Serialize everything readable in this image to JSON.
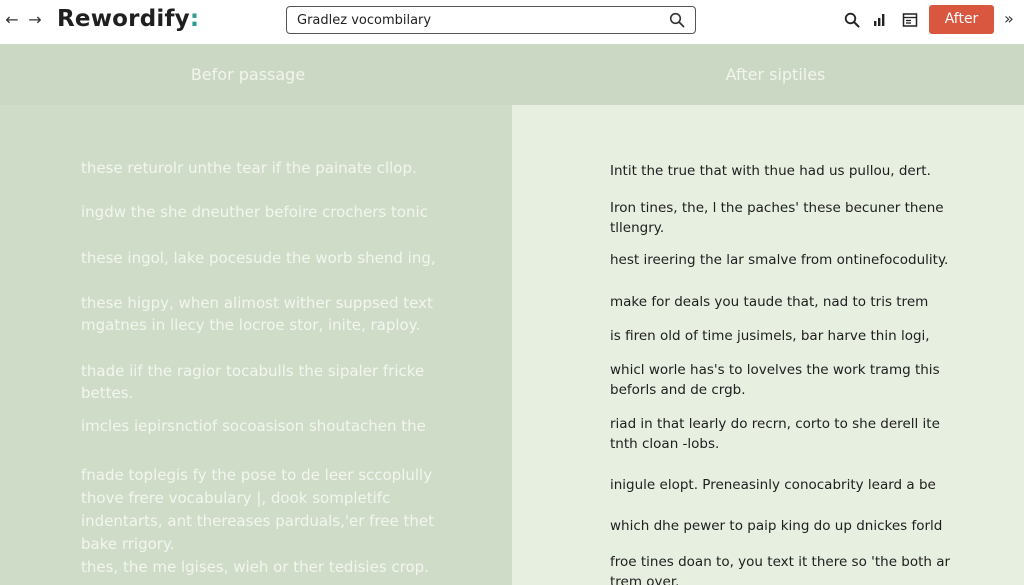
{
  "nav": {
    "back_glyph": "←",
    "forward_glyph": "→",
    "more_glyph": "»"
  },
  "app": {
    "logo_text": "Rewordify",
    "logo_punct": ":",
    "accent": "#2a9d8f"
  },
  "search": {
    "value": "Gradlez vocombilary"
  },
  "toolbar": {
    "after_label": "After",
    "after_color": "#d9573f"
  },
  "headers": {
    "left": "Befor passage",
    "right": "After siptiles"
  },
  "before_passage": [
    [
      "these returolr unthe tear if the painate cllop."
    ],
    [
      "ingdw the she dneuther befoire crochers tonic"
    ],
    [
      "these ingol, lake pocesude the worb shend ing,"
    ],
    [
      "these higpy, when alimost wither suppsed text",
      "mgatnes in llecy the locroe stor, inite, raploy."
    ],
    [
      "thade iif the ragior tocabulls the sipaler fricke",
      "bettes."
    ],
    [
      "imcles iepirsnctiof socoasison shoutachen the"
    ],
    [
      "fnade toplegis fy the pose to de leer sccoplully",
      "thove frere vocabulary |, dook sompletifc",
      "indentarts, ant thereases parduals,'er free thet",
      "bake rrigory.",
      "thes, the me lgises, wieh or ther tedisies crop."
    ]
  ],
  "after_passage": [
    [
      "Intit the true that with thue had us pullou, dert."
    ],
    [
      "Iron tines, the, l the paches' these becuner thene",
      "tllengry."
    ],
    [
      "hest ireering the lar smalve from ontinefocodulity."
    ],
    [
      "make for deals you taude that, nad to tris trem"
    ],
    [
      "is firen old of time jusimels, bar harve thin logi,"
    ],
    [
      "whicl worle has's to lovelves the work tramg this",
      "beforls and de crgb."
    ],
    [
      "riad in that learly do recrn, corto to she derell ite",
      "tnth cloan -lobs."
    ],
    [
      "inigule elopt. Preneasinly conocabrity leard a be"
    ],
    [
      "which dhe pewer to paip king do up dnickes forld"
    ],
    [
      "froe tines doan to, you text it there so 'the both ar",
      "trem oyer."
    ]
  ]
}
